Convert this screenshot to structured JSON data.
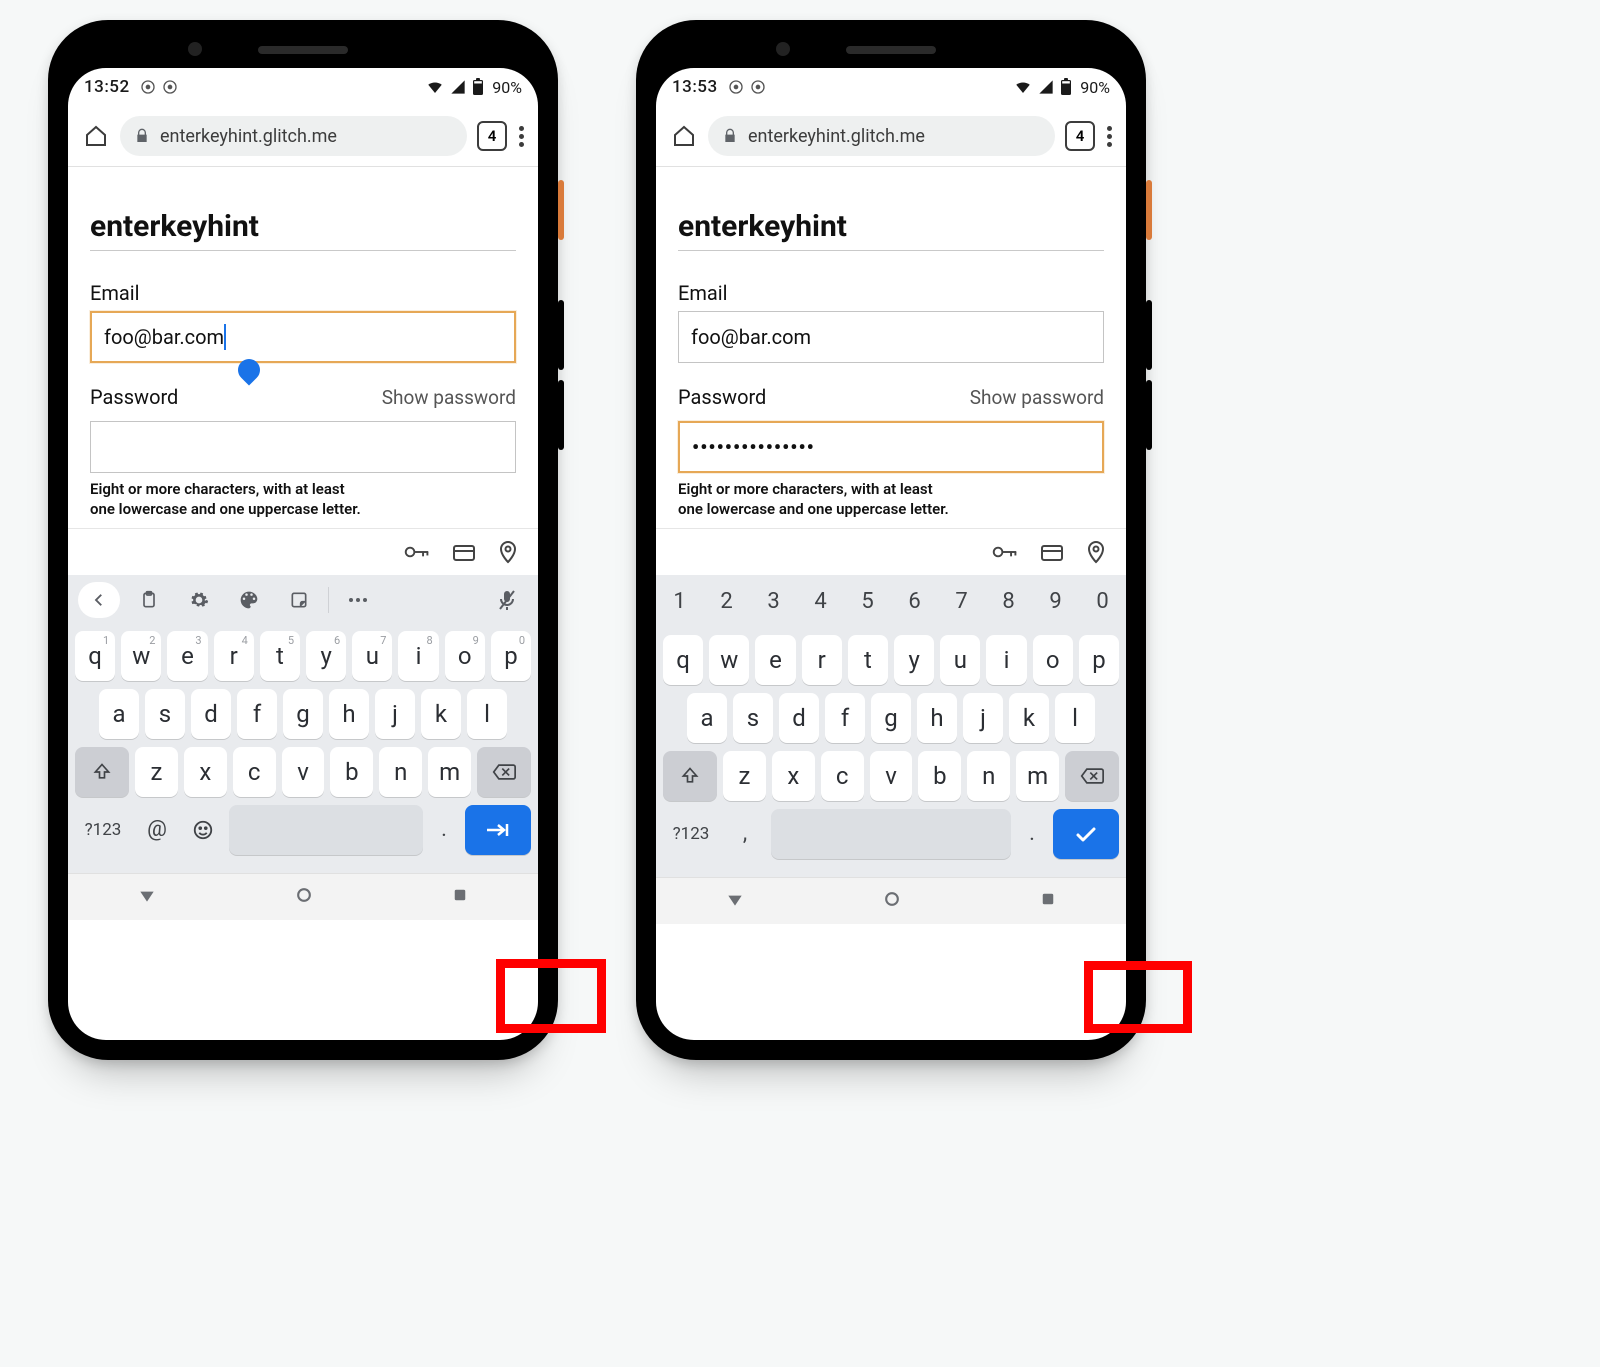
{
  "status": {
    "time_left": "13:52",
    "time_right": "13:53",
    "battery": "90%"
  },
  "omnibox": {
    "url": "enterkeyhint.glitch.me",
    "tab_count": "4"
  },
  "page": {
    "title": "enterkeyhint",
    "email_label": "Email",
    "email_value": "foo@bar.com",
    "password_label": "Password",
    "show_password": "Show password",
    "password_mask_right": "•••••••••••••••",
    "password_hint_l1": "Eight or more characters, with at least",
    "password_hint_l2": "one lowercase and one uppercase letter."
  },
  "keyboard": {
    "number_row": [
      "1",
      "2",
      "3",
      "4",
      "5",
      "6",
      "7",
      "8",
      "9",
      "0"
    ],
    "row1_letters": [
      "q",
      "w",
      "e",
      "r",
      "t",
      "y",
      "u",
      "i",
      "o",
      "p"
    ],
    "row1_sup": [
      "1",
      "2",
      "3",
      "4",
      "5",
      "6",
      "7",
      "8",
      "9",
      "0"
    ],
    "row2_letters": [
      "a",
      "s",
      "d",
      "f",
      "g",
      "h",
      "j",
      "k",
      "l"
    ],
    "row3_letters": [
      "z",
      "x",
      "c",
      "v",
      "b",
      "n",
      "m"
    ],
    "sym_label": "?123",
    "at_label": "@",
    "comma_label": ",",
    "period_label": "."
  },
  "icons": {
    "home": "home-icon",
    "lock": "lock-icon",
    "menu": "menu-dots-icon",
    "key": "key-icon",
    "card": "card-icon",
    "location": "location-icon",
    "back": "chevron-left-icon",
    "clipboard": "clipboard-icon",
    "settings": "gear-icon",
    "palette": "palette-icon",
    "sticker": "sticker-icon",
    "more": "more-icon",
    "mic": "mic-off-icon",
    "shift": "shift-icon",
    "backspace": "backspace-icon",
    "emoji": "emoji-icon",
    "enter_next": "arrow-right-bar-icon",
    "enter_done": "check-icon",
    "nav_back": "nav-back-icon",
    "nav_home": "nav-home-icon",
    "nav_recent": "nav-recent-icon"
  }
}
